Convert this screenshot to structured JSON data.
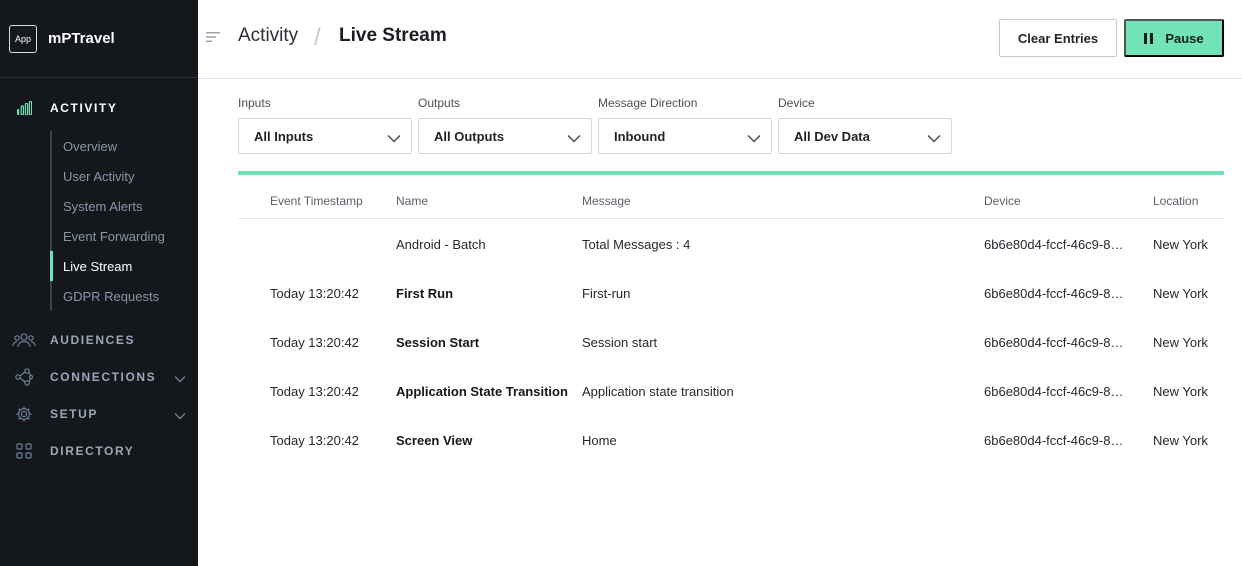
{
  "app": {
    "logo_text": "App",
    "name": "mPTravel"
  },
  "sidebar": {
    "sections": [
      {
        "label": "ACTIVITY",
        "icon": "bar-chart-icon"
      },
      {
        "label": "AUDIENCES",
        "icon": "people-icon"
      },
      {
        "label": "CONNECTIONS",
        "icon": "connections-icon"
      },
      {
        "label": "SETUP",
        "icon": "gear-icon"
      },
      {
        "label": "DIRECTORY",
        "icon": "grid-icon"
      }
    ],
    "activity_items": [
      {
        "label": "Overview"
      },
      {
        "label": "User Activity"
      },
      {
        "label": "System Alerts"
      },
      {
        "label": "Event Forwarding"
      },
      {
        "label": "Live Stream"
      },
      {
        "label": "GDPR Requests"
      }
    ],
    "accent_color": "#72e3b6"
  },
  "header": {
    "breadcrumb": [
      "Activity",
      "Live Stream"
    ],
    "separator": "/",
    "clear_label": "Clear Entries",
    "pause_label": "Pause"
  },
  "filters": [
    {
      "label": "Inputs",
      "value": "All Inputs"
    },
    {
      "label": "Outputs",
      "value": "All Outputs"
    },
    {
      "label": "Message Direction",
      "value": "Inbound"
    },
    {
      "label": "Device",
      "value": "All Dev Data"
    }
  ],
  "table": {
    "columns": [
      "Event Timestamp",
      "Name",
      "Message",
      "Device",
      "Location"
    ],
    "rows": [
      {
        "timestamp": "",
        "name": "Android - Batch",
        "name_bold": false,
        "message": "Total Messages : 4",
        "device": "6b6e80d4-fccf-46c9-8…",
        "location": "New York"
      },
      {
        "timestamp": "Today 13:20:42",
        "name": "First Run",
        "name_bold": true,
        "message": "First-run",
        "device": "6b6e80d4-fccf-46c9-8…",
        "location": "New York"
      },
      {
        "timestamp": "Today 13:20:42",
        "name": "Session Start",
        "name_bold": true,
        "message": "Session start",
        "device": "6b6e80d4-fccf-46c9-8…",
        "location": "New York"
      },
      {
        "timestamp": "Today 13:20:42",
        "name": "Application State Transition",
        "name_bold": true,
        "message": "Application state transition",
        "device": "6b6e80d4-fccf-46c9-8…",
        "location": "New York"
      },
      {
        "timestamp": "Today 13:20:42",
        "name": "Screen View",
        "name_bold": true,
        "message": "Home",
        "device": "6b6e80d4-fccf-46c9-8…",
        "location": "New York"
      }
    ]
  }
}
